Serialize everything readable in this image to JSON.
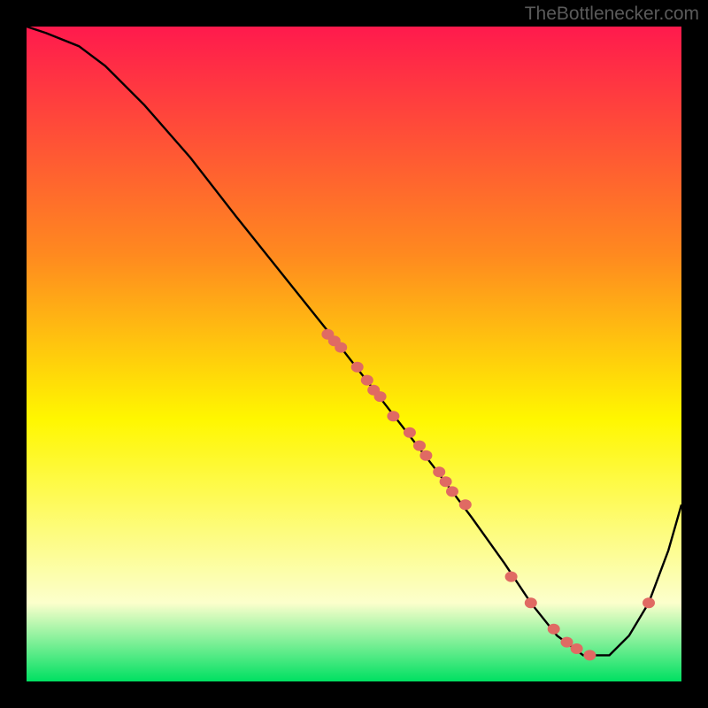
{
  "attribution": "TheBottlenecker.com",
  "colors": {
    "grad_top": "#ff1a4d",
    "grad_mid_high": "#ff8a1f",
    "grad_mid": "#fff700",
    "grad_low": "#fcffcc",
    "grad_bottom": "#00e062",
    "curve": "#000000",
    "marker": "#e06a63"
  },
  "chart_data": {
    "type": "line",
    "title": "",
    "xlabel": "",
    "ylabel": "",
    "xlim": [
      0,
      100
    ],
    "ylim": [
      0,
      100
    ],
    "series": [
      {
        "name": "curve",
        "x": [
          0,
          3,
          8,
          12,
          18,
          25,
          32,
          40,
          48,
          55,
          62,
          68,
          73,
          77,
          81,
          85,
          89,
          92,
          95,
          98,
          100
        ],
        "y": [
          100,
          99,
          97,
          94,
          88,
          80,
          71,
          61,
          51,
          42,
          33,
          25,
          18,
          12,
          7,
          4,
          4,
          7,
          12,
          20,
          27
        ]
      }
    ],
    "markers": {
      "name": "points",
      "x": [
        46,
        47,
        48,
        50.5,
        52,
        53,
        54,
        56,
        58.5,
        60,
        61,
        63,
        64,
        65,
        67,
        74,
        77,
        80.5,
        82.5,
        84,
        86,
        95
      ],
      "y": [
        53,
        52,
        51,
        48,
        46,
        44.5,
        43.5,
        40.5,
        38,
        36,
        34.5,
        32,
        30.5,
        29,
        27,
        16,
        12,
        8,
        6,
        5,
        4,
        12
      ]
    },
    "gradient_note": "vertical gradient from red (top) through orange/yellow/pale-yellow to green (bottom)"
  }
}
